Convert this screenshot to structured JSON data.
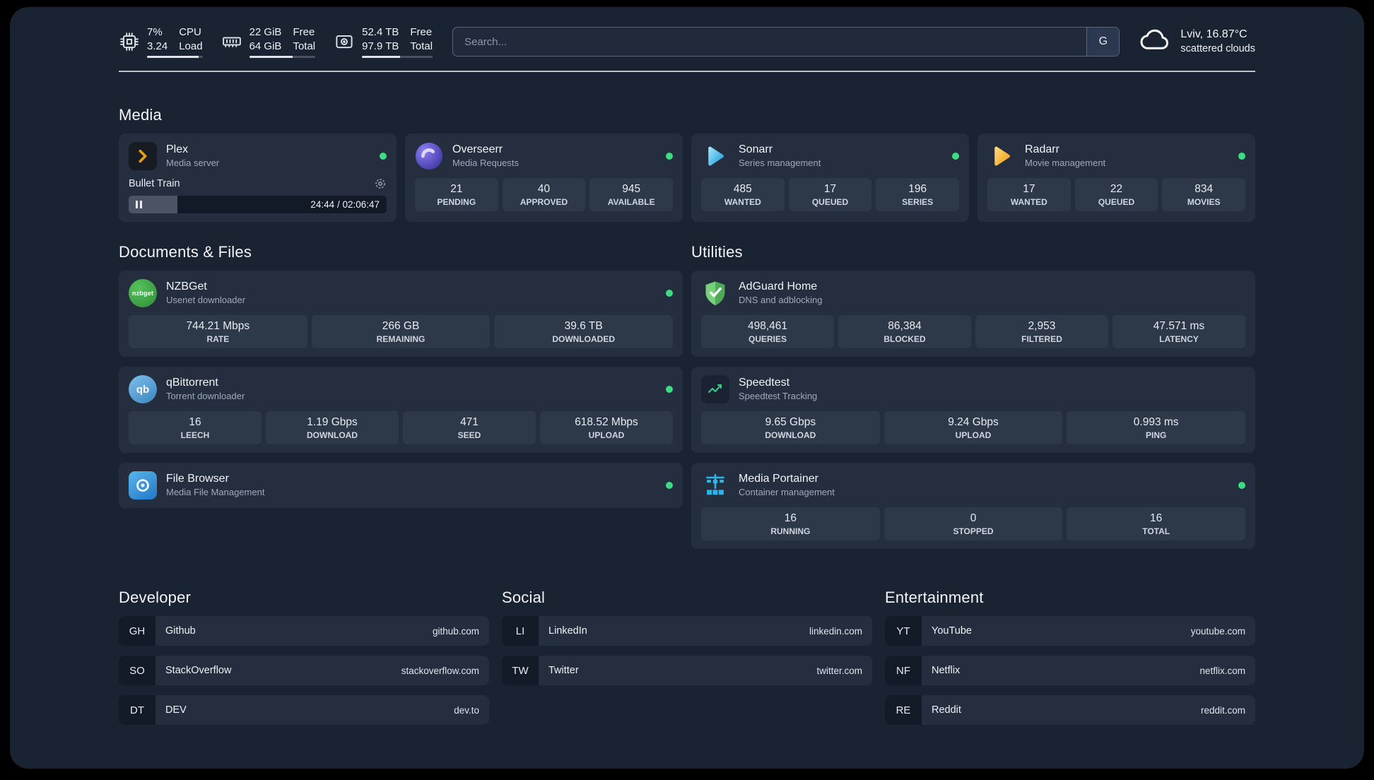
{
  "topbar": {
    "cpu": {
      "percent": "7%",
      "load": "3.24",
      "label_top": "CPU",
      "label_bottom": "Load",
      "bar_pct": 93
    },
    "memory": {
      "free": "22 GiB",
      "total": "64 GiB",
      "label_top": "Free",
      "label_bottom": "Total",
      "bar_pct": 66
    },
    "disk": {
      "free": "52.4 TB",
      "total": "97.9 TB",
      "label_top": "Free",
      "label_bottom": "Total",
      "bar_pct": 54
    },
    "search": {
      "placeholder": "Search...",
      "provider_label": "G"
    },
    "weather": {
      "location": "Lviv, 16.87°C",
      "condition": "scattered clouds",
      "icon": "cloud-icon"
    }
  },
  "sections": {
    "media": {
      "title": "Media",
      "plex": {
        "name": "Plex",
        "desc": "Media server",
        "status": "online",
        "icon": "plex-icon",
        "player": {
          "title": "Bullet Train",
          "time": "24:44 / 02:06:47",
          "progress_pct": 19
        }
      },
      "overseerr": {
        "name": "Overseerr",
        "desc": "Media Requests",
        "status": "online",
        "icon": "overseerr-icon",
        "stats": [
          {
            "value": "21",
            "label": "PENDING"
          },
          {
            "value": "40",
            "label": "APPROVED"
          },
          {
            "value": "945",
            "label": "AVAILABLE"
          }
        ]
      },
      "sonarr": {
        "name": "Sonarr",
        "desc": "Series management",
        "status": "online",
        "icon": "sonarr-icon",
        "stats": [
          {
            "value": "485",
            "label": "WANTED"
          },
          {
            "value": "17",
            "label": "QUEUED"
          },
          {
            "value": "196",
            "label": "SERIES"
          }
        ]
      },
      "radarr": {
        "name": "Radarr",
        "desc": "Movie management",
        "status": "online",
        "icon": "radarr-icon",
        "stats": [
          {
            "value": "17",
            "label": "WANTED"
          },
          {
            "value": "22",
            "label": "QUEUED"
          },
          {
            "value": "834",
            "label": "MOVIES"
          }
        ]
      }
    },
    "documents": {
      "title": "Documents & Files",
      "nzbget": {
        "name": "NZBGet",
        "desc": "Usenet downloader",
        "status": "online",
        "icon": "nzbget-icon",
        "icon_text": "nzbget",
        "stats": [
          {
            "value": "744.21 Mbps",
            "label": "RATE"
          },
          {
            "value": "266 GB",
            "label": "REMAINING"
          },
          {
            "value": "39.6 TB",
            "label": "DOWNLOADED"
          }
        ]
      },
      "qbittorrent": {
        "name": "qBittorrent",
        "desc": "Torrent downloader",
        "status": "online",
        "icon": "qbittorrent-icon",
        "icon_text": "qb",
        "stats": [
          {
            "value": "16",
            "label": "LEECH"
          },
          {
            "value": "1.19 Gbps",
            "label": "DOWNLOAD"
          },
          {
            "value": "471",
            "label": "SEED"
          },
          {
            "value": "618.52 Mbps",
            "label": "UPLOAD"
          }
        ]
      },
      "filebrowser": {
        "name": "File Browser",
        "desc": "Media File Management",
        "status": "online",
        "icon": "filebrowser-icon"
      }
    },
    "utilities": {
      "title": "Utilities",
      "adguard": {
        "name": "AdGuard Home",
        "desc": "DNS and adblocking",
        "icon": "adguard-icon",
        "stats": [
          {
            "value": "498,461",
            "label": "QUERIES"
          },
          {
            "value": "86,384",
            "label": "BLOCKED"
          },
          {
            "value": "2,953",
            "label": "FILTERED"
          },
          {
            "value": "47.571 ms",
            "label": "LATENCY"
          }
        ]
      },
      "speedtest": {
        "name": "Speedtest",
        "desc": "Speedtest Tracking",
        "icon": "speedtest-icon",
        "stats": [
          {
            "value": "9.65 Gbps",
            "label": "DOWNLOAD"
          },
          {
            "value": "9.24 Gbps",
            "label": "UPLOAD"
          },
          {
            "value": "0.993 ms",
            "label": "PING"
          }
        ]
      },
      "portainer": {
        "name": "Media Portainer",
        "desc": "Container management",
        "status": "online",
        "icon": "portainer-icon",
        "stats": [
          {
            "value": "16",
            "label": "RUNNING"
          },
          {
            "value": "0",
            "label": "STOPPED"
          },
          {
            "value": "16",
            "label": "TOTAL"
          }
        ]
      }
    },
    "bookmarks": {
      "developer": {
        "title": "Developer",
        "items": [
          {
            "abbr": "GH",
            "name": "Github",
            "url": "github.com"
          },
          {
            "abbr": "SO",
            "name": "StackOverflow",
            "url": "stackoverflow.com"
          },
          {
            "abbr": "DT",
            "name": "DEV",
            "url": "dev.to"
          }
        ]
      },
      "social": {
        "title": "Social",
        "items": [
          {
            "abbr": "LI",
            "name": "LinkedIn",
            "url": "linkedin.com"
          },
          {
            "abbr": "TW",
            "name": "Twitter",
            "url": "twitter.com"
          }
        ]
      },
      "entertainment": {
        "title": "Entertainment",
        "items": [
          {
            "abbr": "YT",
            "name": "YouTube",
            "url": "youtube.com"
          },
          {
            "abbr": "NF",
            "name": "Netflix",
            "url": "netflix.com"
          },
          {
            "abbr": "RE",
            "name": "Reddit",
            "url": "reddit.com"
          }
        ]
      }
    }
  },
  "colors": {
    "page_bg": "#1a2332",
    "card_bg": "#242e3e",
    "stat_bg": "#2d3849",
    "status_online": "#3ddc84",
    "accent_plex": "#e5a00d",
    "accent_overseerr": "#6d5ce8",
    "accent_sonarr": "#35c5f4",
    "accent_radarr": "#f5a623",
    "accent_nzbget": "#3fa549",
    "accent_qbittorrent": "#5a9fd4",
    "accent_filebrowser": "#3d8fd1",
    "accent_adguard": "#68bc71",
    "accent_speedtest": "#35d08e",
    "accent_portainer": "#2cb5ea"
  }
}
